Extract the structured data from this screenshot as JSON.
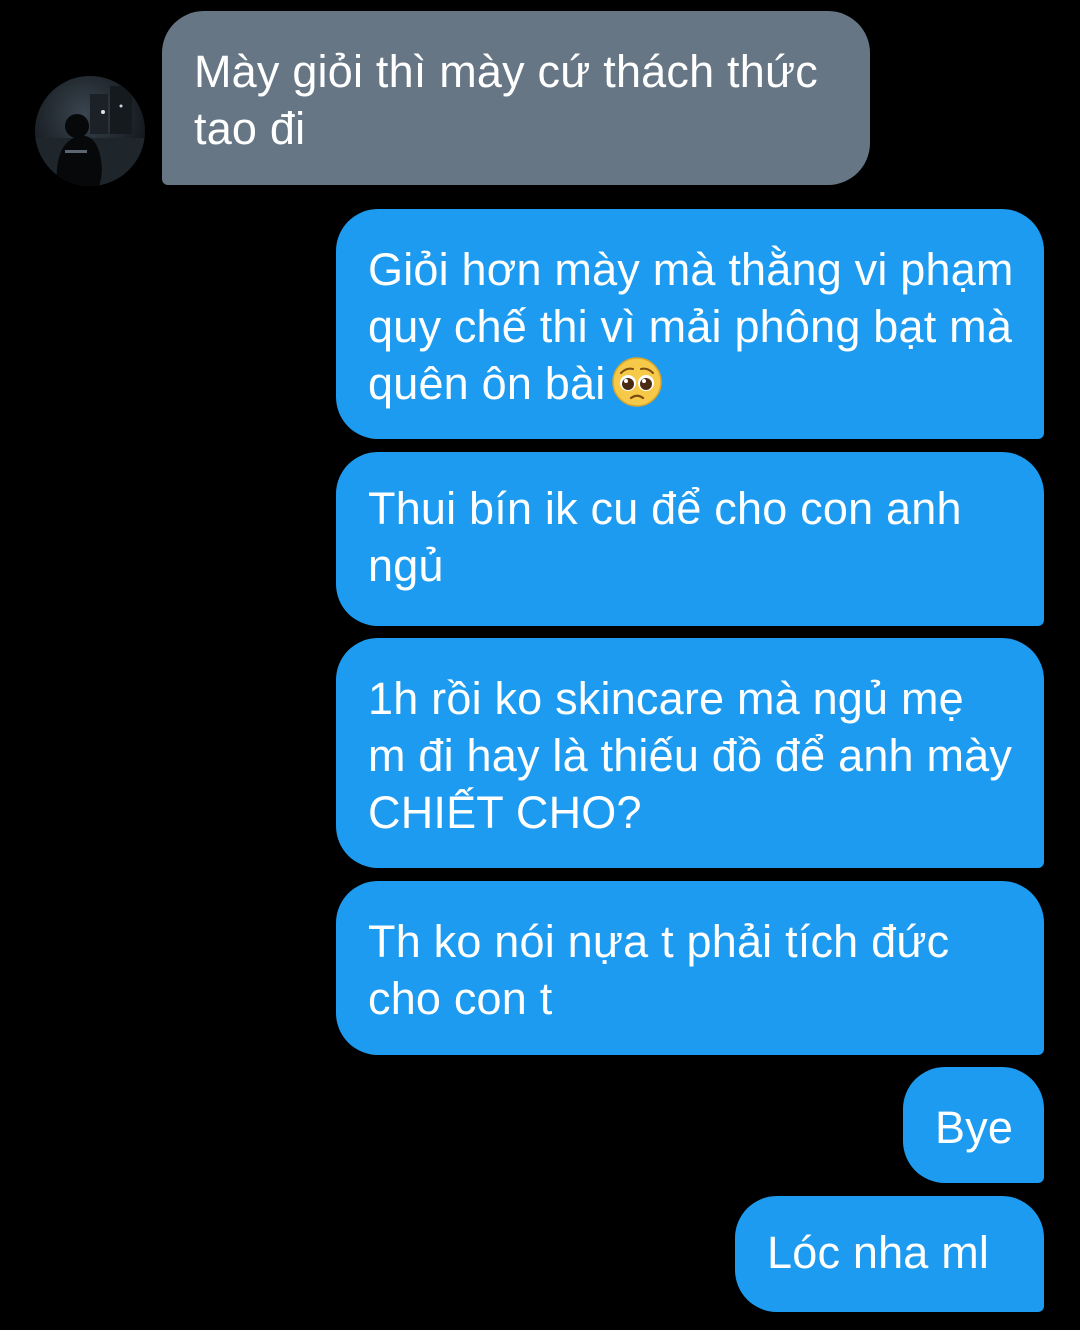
{
  "conversation": {
    "incoming": [
      {
        "text": "Mày giỏi thì mày cứ thách thức tao đi"
      }
    ],
    "outgoing": [
      {
        "text": "Giỏi hơn mày mà thằng vi phạm quy chế thi vì mải phông bạt mà quên ôn bài",
        "emoji": "pleading-face-icon"
      },
      {
        "text": "Thui bín ik cu để cho con anh ngủ"
      },
      {
        "text": "1h rồi ko skincare mà ngủ mẹ m đi hay là thiếu đồ để anh mày CHIẾT CHO?"
      },
      {
        "text": "Th ko nói nựa t phải tích đức cho con t"
      },
      {
        "text": "Bye"
      },
      {
        "text": "Lóc nha ml"
      }
    ]
  },
  "colors": {
    "background": "#000000",
    "incoming_bubble": "#667685",
    "outgoing_bubble": "#1d9bf0",
    "text": "#ffffff"
  }
}
